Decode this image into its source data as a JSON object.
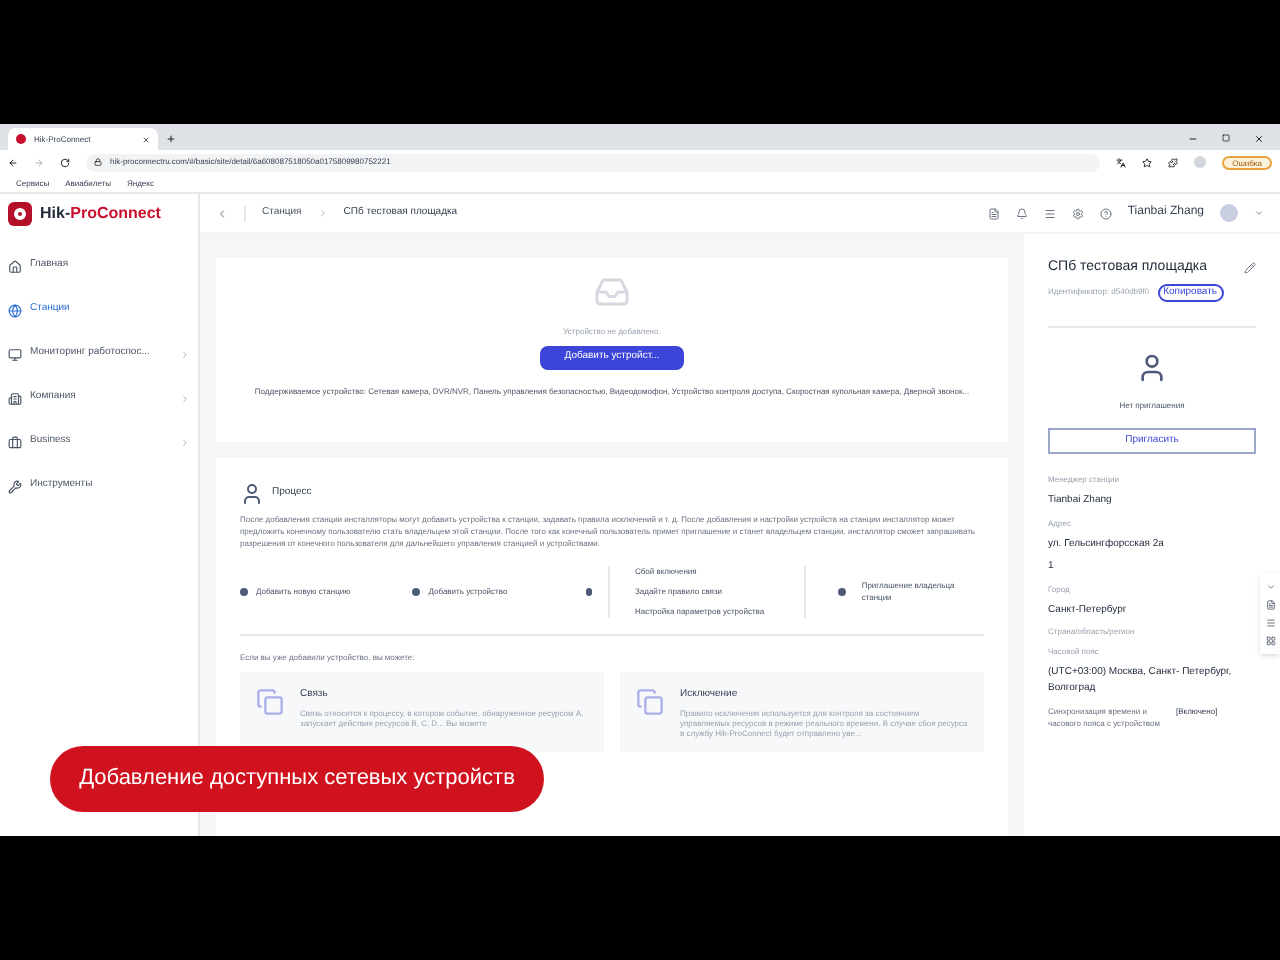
{
  "browser": {
    "tab_title": "Hik-ProConnect",
    "url": "hik-proconnectru.com/#/basic/site/detail/6a608087518050a0175809980752221",
    "error_button": "Ошибка",
    "bookmarks": [
      "Сервисы",
      "Авиабилеты",
      "Яндекс"
    ]
  },
  "logo": {
    "prefix": "Hik-",
    "name": "ProConnect"
  },
  "sidebar": {
    "items": [
      {
        "label": "Главная",
        "selected": false,
        "expandable": false
      },
      {
        "label": "Станции",
        "selected": true,
        "expandable": false
      },
      {
        "label": "Мониторинг работоспос...",
        "selected": false,
        "expandable": true
      },
      {
        "label": "Компания",
        "selected": false,
        "expandable": true
      },
      {
        "label": "Business",
        "selected": false,
        "expandable": true
      },
      {
        "label": "Инструменты",
        "selected": false,
        "expandable": false
      }
    ]
  },
  "header": {
    "breadcrumb": [
      "Станция",
      "СПб тестовая площадка"
    ],
    "user": "Tianbai Zhang"
  },
  "empty_state": {
    "message": "Устройство не добавлено.",
    "button": "Добавить устройст...",
    "supported": "Поддерживаемое устройство: Сетевая камера, DVR/NVR, Панель управления безопасностью, Видеодомофон, Устройство контроля доступа, Скоростная купольная камера, Дверной звонок..."
  },
  "process": {
    "title": "Процесс",
    "text": "После добавления станции инсталляторы могут добавить устройства к станции, задавать правила исключений и т. д. После добавления и настройки устройств на станции инсталлятор может предложить конечному пользователю стать владельцем этой станции. После того как конечный пользователь примет приглашение и станет владельцем станции, инсталлятор сможет запрашивать разрешения от конечного пользователя для дальнейшего управления станцией и устройствами.",
    "steps": [
      "Добавить новую станцию",
      "Добавить устройство"
    ],
    "branches": [
      "Сбой включения",
      "Задайте правило связи",
      "Настройка параметров устройства"
    ],
    "final_step": "Приглашение владельца станции",
    "hint": "Если вы уже добавили устройство, вы можете:",
    "cards": [
      {
        "title": "Связь",
        "text": "Связь относится к процессу, в котором событие, обнаруженное ресурсом A, запускает действия ресурсов B, C, D... Вы можете"
      },
      {
        "title": "Исключение",
        "text": "Правило исключения используется для контроля за состоянием управляемых ресурсов в режиме реального времени. В случае сбоя ресурса в службу Hik-ProConnect будет отправлено уве..."
      }
    ]
  },
  "site_panel": {
    "title": "СПб тестовая площадка",
    "identifier": "Идентификатор: d540db9f0",
    "copy_button": "Копировать",
    "invite_status": "Нет приглашения",
    "invite_button": "Пригласить",
    "fields": [
      {
        "label": "Менеджер станции",
        "values": [
          "Tianbai Zhang"
        ]
      },
      {
        "label": "Адрес",
        "values": [
          "ул. Гельсингфорсская 2а",
          "1"
        ]
      },
      {
        "label": "Город",
        "values": [
          "Санкт-Петербург"
        ]
      },
      {
        "label": "Страна/область/регион"
      },
      {
        "label": "Часовой пояс",
        "values": [
          "(UTC+03:00) Москва, Санкт- Петербург, Волгоград"
        ]
      }
    ],
    "sync": {
      "label": "Синхронизация времени и часового пояса с устройством",
      "value": "[Включено]"
    }
  },
  "caption": "Добавление доступных сетевых устройств"
}
